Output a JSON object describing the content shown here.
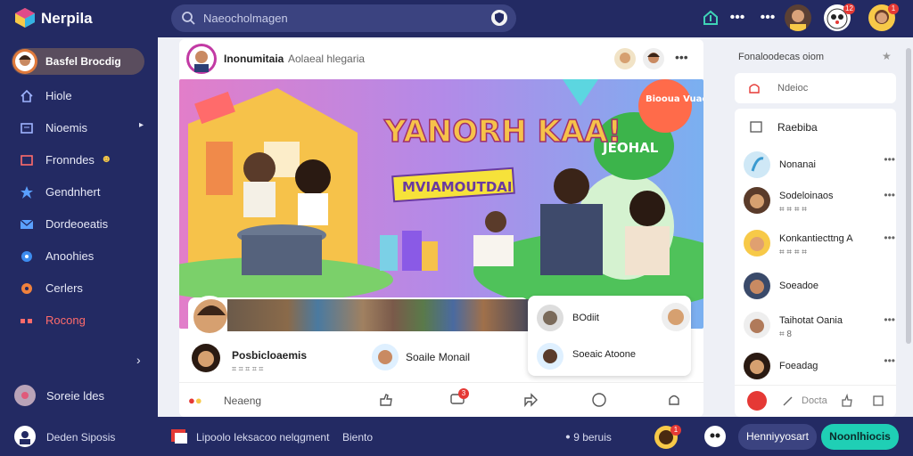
{
  "app": {
    "brand": "Nerpila"
  },
  "search": {
    "placeholder": "Naeocholmagen"
  },
  "topbar": {
    "badges": [
      "12",
      "1"
    ]
  },
  "sidebar": {
    "profile_label": "Basfel Brocdig",
    "items": [
      {
        "label": "Hiole",
        "icon": "home-icon"
      },
      {
        "label": "Nioemis",
        "icon": "news-icon"
      },
      {
        "label": "Fronndes",
        "icon": "friends-icon"
      },
      {
        "label": "Gendnhert",
        "icon": "star-icon"
      },
      {
        "label": "Dordeoeatis",
        "icon": "mail-icon"
      },
      {
        "label": "Anoohies",
        "icon": "location-icon"
      },
      {
        "label": "Cerlers",
        "icon": "circle-icon"
      },
      {
        "label": "Rocong",
        "icon": "dots-icon"
      }
    ],
    "bottom_label": "Soreie ldes"
  },
  "post": {
    "author": "Inonumitaia",
    "meta": "Aolaeal hlegaria",
    "banner_title": "YANORH KAA!",
    "banner_banner": "MVIAMOUTDAI",
    "bubble_speech": "JEOHAL",
    "bubble_corner": "Biooua Vuaen",
    "stories": [
      {
        "name": "Posbicloaemis"
      },
      {
        "name": "Soaile Monail"
      }
    ],
    "popup": [
      {
        "name": "BOdiit"
      },
      {
        "name": "Soeaic Atoone"
      }
    ],
    "reactions_label": "Neaeng",
    "reaction_badges": [
      "3"
    ]
  },
  "rightcol": {
    "header": "Fonaloodecas oiom",
    "header_card": "Ndeioc",
    "section_title": "Raebiba",
    "contacts": [
      {
        "name": "Nonanai",
        "sub": ""
      },
      {
        "name": "Sodeloinaos",
        "sub": "⌗ ⌗ ⌗ ⌗"
      },
      {
        "name": "Konkantiecttng A",
        "sub": "⌗ ⌗ ⌗ ⌗"
      },
      {
        "name": "Soeadoe",
        "sub": ""
      },
      {
        "name": "Taihotat Oania",
        "sub": "⌗ 8"
      },
      {
        "name": "Foeadag",
        "sub": ""
      }
    ],
    "footer_label": "Docta"
  },
  "bottombar": {
    "user": "Deden Siposis",
    "notice": "Lipoolo Ieksacoo nelqgment",
    "extra": "Biento",
    "status": "ꔷ 9 beruis",
    "btn_dark": "Henniyyosart",
    "btn_teal": "Noonlhiocis",
    "badge": "1"
  },
  "colors": {
    "nav": "#232a63",
    "accent_teal": "#1fcfb5",
    "alert": "#e53935",
    "feed_bg": "#ffffff"
  }
}
